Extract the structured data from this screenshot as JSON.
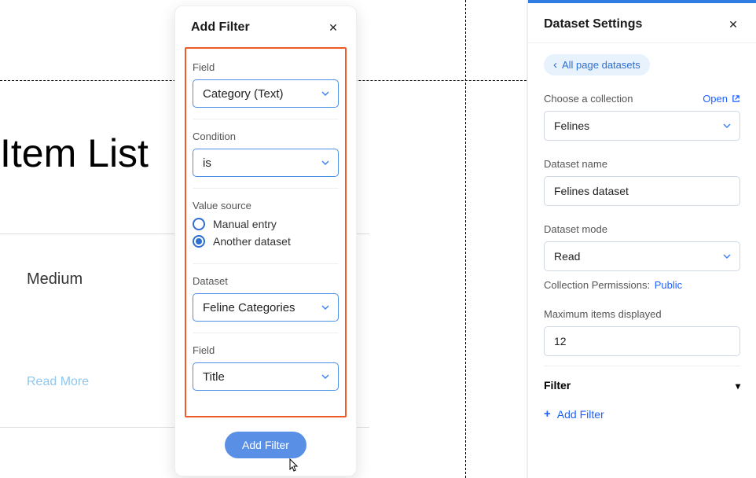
{
  "canvas": {
    "page_title": "Item List",
    "card_tag": "Medium",
    "card_readmore": "Read More"
  },
  "modal": {
    "title": "Add Filter",
    "field_label": "Field",
    "field_value": "Category (Text)",
    "condition_label": "Condition",
    "condition_value": "is",
    "value_source_label": "Value source",
    "radio_manual": "Manual entry",
    "radio_another": "Another dataset",
    "radio_selected": "another",
    "dataset_label": "Dataset",
    "dataset_value": "Feline Categories",
    "field2_label": "Field",
    "field2_value": "Title",
    "submit_label": "Add Filter"
  },
  "rail": {
    "title": "Dataset Settings",
    "back_pill": "All page datasets",
    "choose_collection_label": "Choose a collection",
    "open_label": "Open",
    "collection_value": "Felines",
    "dataset_name_label": "Dataset name",
    "dataset_name_value": "Felines dataset",
    "dataset_mode_label": "Dataset mode",
    "dataset_mode_value": "Read",
    "permissions_label": "Collection Permissions:",
    "permissions_value": "Public",
    "max_items_label": "Maximum items displayed",
    "max_items_value": "12",
    "filter_heading": "Filter",
    "add_filter_label": "Add Filter"
  }
}
